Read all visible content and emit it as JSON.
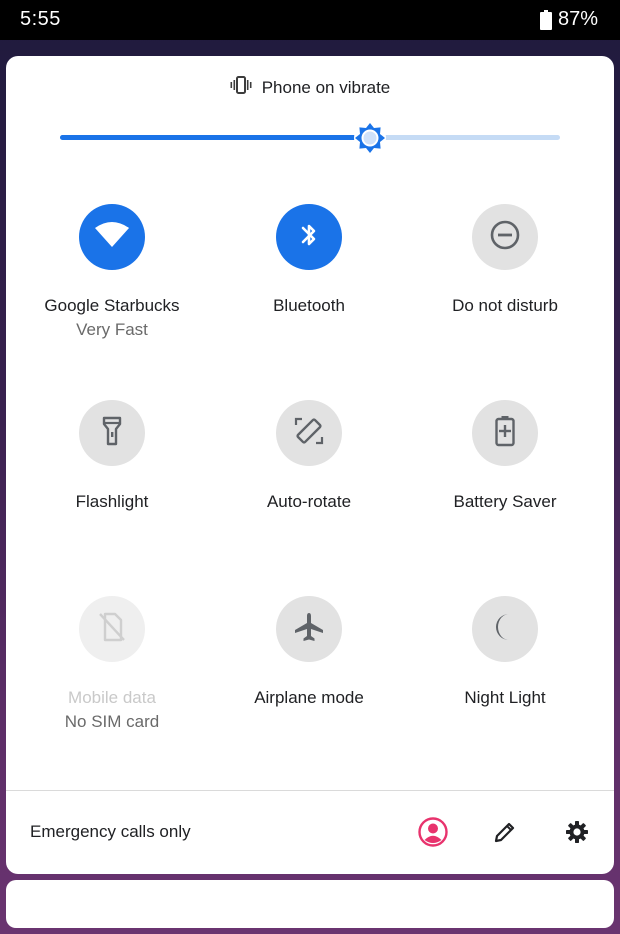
{
  "status_bar": {
    "time": "5:55",
    "battery_percent": "87%",
    "battery_icon": "battery-icon"
  },
  "ringer": {
    "icon": "vibrate-icon",
    "label": "Phone on vibrate"
  },
  "brightness": {
    "level": 0.62,
    "icon": "brightness-icon",
    "accent_color": "#1a73e8",
    "track_color": "#c5dbf5"
  },
  "tiles": [
    {
      "label": "Google Starbucks",
      "sub": "Very Fast",
      "icon": "wifi-icon",
      "state": "on"
    },
    {
      "label": "Bluetooth",
      "sub": "",
      "icon": "bluetooth-icon",
      "state": "on"
    },
    {
      "label": "Do not disturb",
      "sub": "",
      "icon": "do-not-disturb-icon",
      "state": "off"
    },
    {
      "label": "Flashlight",
      "sub": "",
      "icon": "flashlight-icon",
      "state": "off"
    },
    {
      "label": "Auto-rotate",
      "sub": "",
      "icon": "auto-rotate-icon",
      "state": "off"
    },
    {
      "label": "Battery Saver",
      "sub": "",
      "icon": "battery-saver-icon",
      "state": "off"
    },
    {
      "label": "Mobile data",
      "sub": "No SIM card",
      "icon": "mobile-data-off-icon",
      "state": "disabled"
    },
    {
      "label": "Airplane mode",
      "sub": "",
      "icon": "airplane-icon",
      "state": "off"
    },
    {
      "label": "Night Light",
      "sub": "",
      "icon": "night-light-icon",
      "state": "off"
    }
  ],
  "footer": {
    "text": "Emergency calls only",
    "user_icon": "user-account-icon",
    "user_color": "#e8336d",
    "edit_icon": "edit-pencil-icon",
    "settings_icon": "settings-gear-icon"
  }
}
